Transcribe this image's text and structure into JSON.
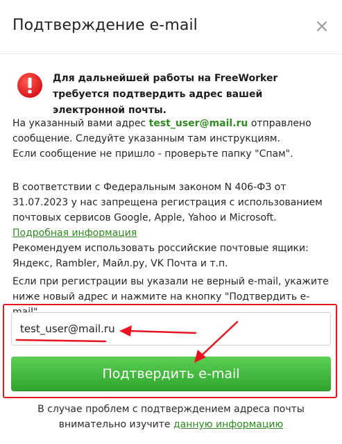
{
  "dialog": {
    "title": "Подтверждение e-mail",
    "close_icon": "close-icon",
    "close_glyph": "×"
  },
  "alert": {
    "icon": "exclamation-circle-icon",
    "icon_color": "#e8222a",
    "text": "Для дальнейшей работы на FreeWorker требуется подтвердить адрес вашей электронной почты."
  },
  "info": {
    "p1_before": "На указанный вами адрес ",
    "p1_email": "test_user@mail.ru",
    "p1_after": " отправлено сообщение. Следуйте указанным там инструкциям.",
    "p1_line3": "Если сообщение не пришло - проверьте папку \"Спам\".",
    "p2_text": "В соответствии с Федеральным законом N 406-ФЗ от 31.07.2023 у нас запрещена регистрация с использованием почтовых сервисов Google, Apple, Yahoo и Microsoft. ",
    "p2_link": "Подробная информация",
    "p2_text2": "Рекомендуем использовать российские почтовые ящики: Яндекс, Rambler, Майл.ру, VK Почта и т.п.",
    "p3_text": "Если при регистрации вы указали не верный e-mail, укажите ниже новый адрес и нажмите на кнопку \"Подтвердить e-mail\"."
  },
  "form": {
    "email_value": "test_user@mail.ru",
    "submit_label": "Подтвердить e-mail"
  },
  "footer": {
    "text": "В случае проблем с подтверждением адреса почты внимательно изучите ",
    "link": "данную информацию"
  },
  "colors": {
    "accent_green": "#2e8b1f",
    "button_green": "#3db838",
    "annotation_red": "#e8131e"
  }
}
